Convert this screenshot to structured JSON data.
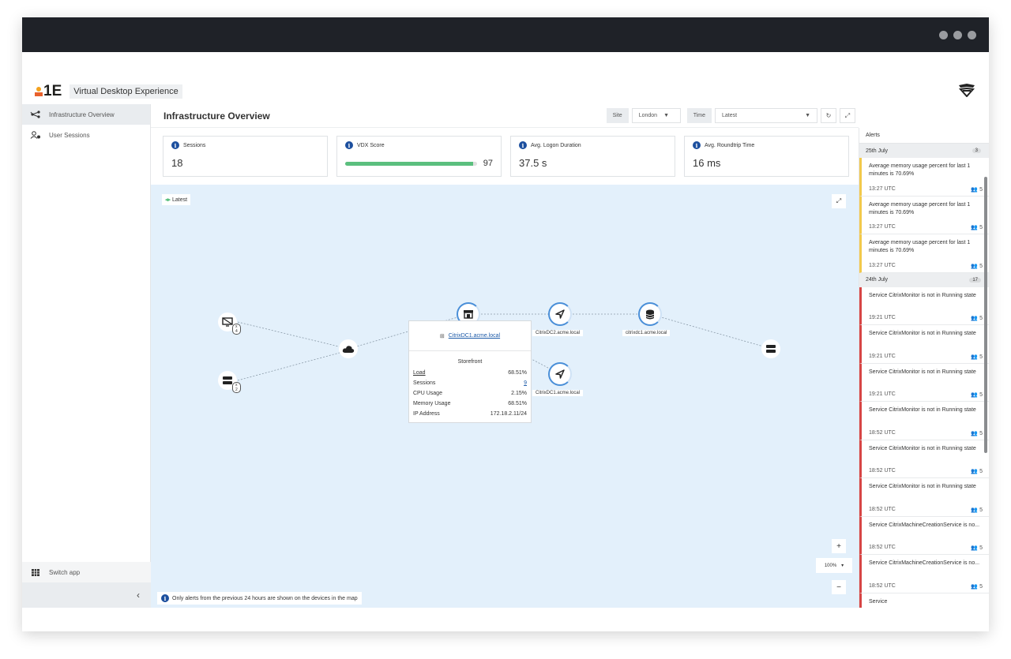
{
  "app": {
    "name": "Virtual Desktop Experience",
    "logo_text": "1E"
  },
  "sidebar": {
    "items": [
      {
        "label": "Infrastructure Overview",
        "icon": "network-icon"
      },
      {
        "label": "User Sessions",
        "icon": "user-sessions-icon"
      }
    ],
    "switch_label": "Switch app",
    "collapse_glyph": "‹"
  },
  "header": {
    "title": "Infrastructure Overview",
    "site_label": "Site",
    "site_value": "London",
    "time_label": "Time",
    "time_value": "Latest"
  },
  "cards": [
    {
      "title": "Sessions",
      "value": "18"
    },
    {
      "title": "VDX Score",
      "value": "97",
      "progress_percent": 97,
      "bar_color": "#5bbf7e"
    },
    {
      "title": "Avg. Logon Duration",
      "value": "37.5 s"
    },
    {
      "title": "Avg. Roundtrip Time",
      "value": "16 ms"
    }
  ],
  "map": {
    "latest_label": "Latest",
    "badges": [
      "x 4",
      "x 2"
    ],
    "nodes": {
      "citrixdc2": "CitrixDC2.acme.local",
      "citrixdc1_db": "citrixdc1.acme.local",
      "citrixdc1": "CitrixDC1.acme.local"
    },
    "popup": {
      "host": "CitrixDC1.acme.local",
      "role": "Storefront",
      "rows": [
        {
          "k": "Load",
          "v": "68.51%"
        },
        {
          "k": "Sessions",
          "v": "9"
        },
        {
          "k": "CPU Usage",
          "v": "2.15%"
        },
        {
          "k": "Memory Usage",
          "v": "68.51%"
        },
        {
          "k": "IP Address",
          "v": "172.18.2.11/24"
        }
      ]
    },
    "zoom_in": "+",
    "zoom_out": "−",
    "zoom_level": "100%",
    "note": "Only alerts from the previous 24 hours are shown on the devices in the map"
  },
  "alerts": {
    "title": "Alerts",
    "groups": [
      {
        "date": "25th July",
        "count": "3",
        "items": [
          {
            "msg": "Average memory usage percent for last 1 minutes is 70.69%",
            "time": "13:27 UTC",
            "users": "5",
            "severity": "warning"
          },
          {
            "msg": "Average memory usage percent for last 1 minutes is 70.69%",
            "time": "13:27 UTC",
            "users": "5",
            "severity": "warning"
          },
          {
            "msg": "Average memory usage percent for last 1 minutes is 70.69%",
            "time": "13:27 UTC",
            "users": "5",
            "severity": "warning"
          }
        ]
      },
      {
        "date": "24th July",
        "count": "17",
        "items": [
          {
            "msg": "Service CitrixMonitor is not in Running state",
            "time": "19:21 UTC",
            "users": "5",
            "severity": "error"
          },
          {
            "msg": "Service CitrixMonitor is not in Running state",
            "time": "19:21 UTC",
            "users": "5",
            "severity": "error"
          },
          {
            "msg": "Service CitrixMonitor is not in Running state",
            "time": "19:21 UTC",
            "users": "5",
            "severity": "error"
          },
          {
            "msg": "Service CitrixMonitor is not in Running state",
            "time": "18:52 UTC",
            "users": "5",
            "severity": "error"
          },
          {
            "msg": "Service CitrixMonitor is not in Running state",
            "time": "18:52 UTC",
            "users": "5",
            "severity": "error"
          },
          {
            "msg": "Service CitrixMonitor is not in Running state",
            "time": "18:52 UTC",
            "users": "5",
            "severity": "error"
          },
          {
            "msg": "Service CitrixMachineCreationService is no...",
            "time": "18:52 UTC",
            "users": "5",
            "severity": "error"
          },
          {
            "msg": "Service CitrixMachineCreationService is no...",
            "time": "18:52 UTC",
            "users": "5",
            "severity": "error"
          },
          {
            "msg": "Service",
            "time": "",
            "users": "",
            "severity": "error"
          }
        ]
      }
    ]
  }
}
